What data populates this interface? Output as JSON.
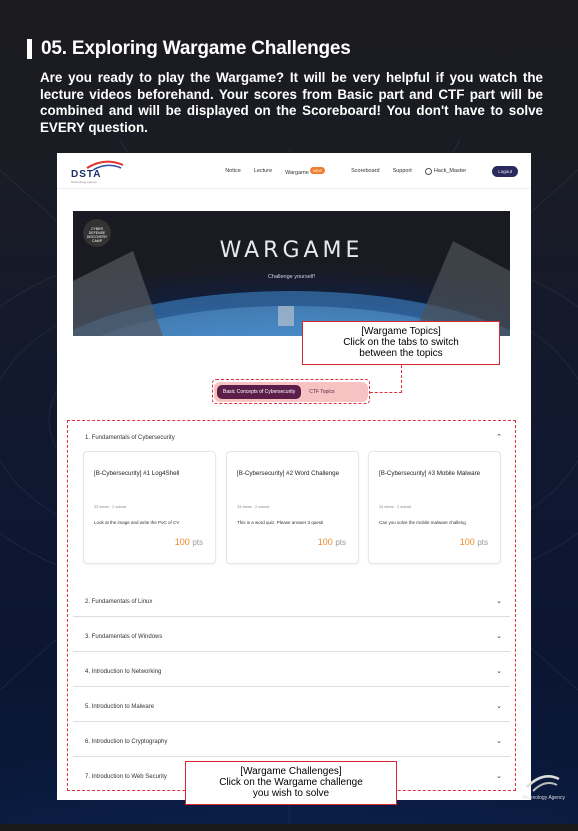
{
  "section": {
    "title": "05. Exploring Wargame Challenges",
    "intro": "Are you ready to play the Wargame? It will be very helpful if you watch the lecture videos beforehand. Your scores from Basic part and CTF part will be combined and will be displayed on the Scoreboard! You don't have to solve EVERY question."
  },
  "site": {
    "logo_text": "DSTA",
    "logo_sub": "Technology Agency",
    "menu": [
      "Notice",
      "Lecture",
      "Wargame",
      "Scoreboard",
      "Support"
    ],
    "wargame_badge": "NEW",
    "username": "Hack_Master",
    "logout_label": "Logout",
    "banner_badge": "CYBER DEFENSE DISCOVERY CAMP",
    "banner_title": "WARGAME",
    "banner_subtitle": "Challenge yourself!",
    "tabs": [
      "Basic Concepts of Cybersecurity",
      "CTF Topics"
    ],
    "accordion_open": "1. Fundamentals of Cybersecurity",
    "cards": [
      {
        "title": "[B-Cybersecurity] #1 Log4Shell",
        "meta": "33 views · 2 solved",
        "desc": "Look at the image and write the PoC of CV",
        "points": "100",
        "unit": "pts"
      },
      {
        "title": "[B-Cybersecurity] #2 Word Challenge",
        "meta": "33 views · 2 solved",
        "desc": "This is a word quiz. Please answer 3 questi",
        "points": "100",
        "unit": "pts"
      },
      {
        "title": "[B-Cybersecurity] #3 Mobile Malware",
        "meta": "28 views · 2 solved",
        "desc": "Can you solve the mobile malware challeng",
        "points": "100",
        "unit": "pts"
      }
    ],
    "accordion_closed": [
      "2. Fundamentals of Linux",
      "3. Fundamentals of Windows",
      "4. Introduction to Networking",
      "5. Introduction to Malware",
      "6. Introduction to Cryptography",
      "7. Introduction to Web Security"
    ]
  },
  "callouts": {
    "topics": [
      "[Wargame Topics]",
      "Click on the tabs to switch",
      "between the topics"
    ],
    "challenges": [
      "[Wargame Challenges]",
      "Click on the Wargame challenge",
      "you wish to solve"
    ]
  },
  "corner_text": "Technology Agency"
}
